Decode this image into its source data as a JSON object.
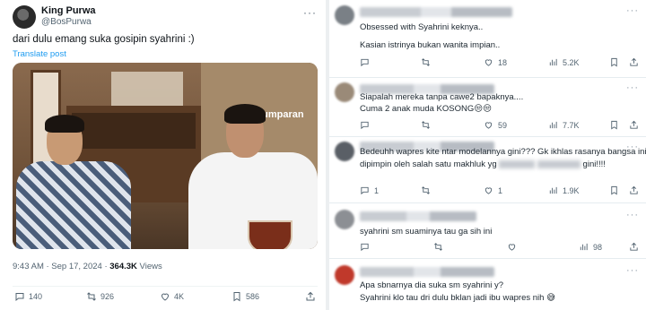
{
  "tweet": {
    "author_name": "King Purwa",
    "author_handle": "@BosPurwa",
    "more": "···",
    "text": "dari dulu emang suka gosipin syahrini :)",
    "translate": "Translate post",
    "media_watermark": "kumparan",
    "time": "9:43 AM · Sep 17, 2024 · ",
    "views_count": "364.3K",
    "views_label": " Views",
    "stats": {
      "replies": "140",
      "reposts": "926",
      "likes": "4K",
      "bookmarks": "586"
    }
  },
  "replies": [
    {
      "avatar_color": "#7a8086",
      "lines": [
        "Obsessed with Syahrini keknya..",
        "",
        "Kasian istrinya bukan wanita impian.."
      ],
      "stats": {
        "reposts": "",
        "likes": "18",
        "views": "5.2K"
      }
    },
    {
      "avatar_color": "#9a8a78",
      "lines": [
        "Siapalah mereka tanpa cawe2 bapaknya....",
        "Cuma 2 anak muda KOSONG😒😒"
      ],
      "stats": {
        "reposts": "",
        "likes": "59",
        "views": "7.7K"
      }
    },
    {
      "avatar_color": "#5a5f66",
      "lines": [
        "Bedeuhh wapres kite ntar modelannya gini??? Gk ikhlas rasanya bangsa ini",
        "dipimpin oleh salah satu makhluk yg",
        "gini!!!!"
      ],
      "stats": {
        "replies": "1",
        "reposts": "",
        "likes": "1",
        "views": "1.9K"
      }
    },
    {
      "avatar_color": "#8c8f94",
      "lines": [
        "syahrini sm suaminya tau ga sih ini"
      ],
      "stats": {
        "reposts": "",
        "likes": "",
        "views": "98"
      }
    },
    {
      "avatar_color": "#c0392b",
      "lines": [
        "Apa sbnarnya dia suka sm syahrini y?",
        "Syahrini klo tau dri dulu bklan jadi ibu wapres nih 😅"
      ],
      "stats": {}
    }
  ]
}
